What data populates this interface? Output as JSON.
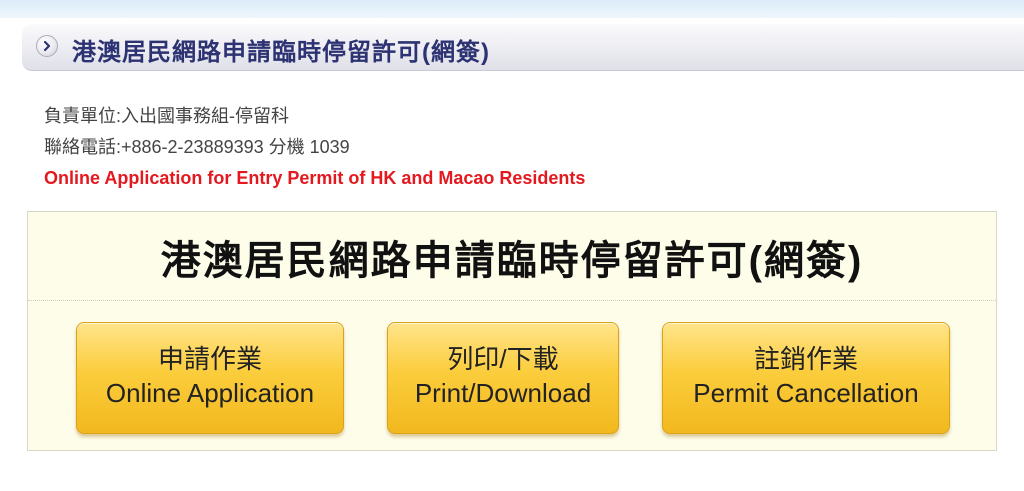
{
  "header": {
    "title": "港澳居民網路申請臨時停留許可(網簽)",
    "icon": "chevron-right-circle-icon"
  },
  "info": {
    "department": "負責單位:入出國事務組-停留科",
    "phone": "聯絡電話:+886-2-23889393 分機 1039",
    "english_title": "Online Application for Entry Permit of HK and Macao Residents"
  },
  "panel": {
    "heading": "港澳居民網路申請臨時停留許可(網簽)",
    "buttons": [
      {
        "label_zh": "申請作業",
        "label_en": "Online Application"
      },
      {
        "label_zh": "列印/下載",
        "label_en": "Print/Download"
      },
      {
        "label_zh": "註銷作業",
        "label_en": "Permit Cancellation"
      }
    ]
  },
  "colors": {
    "title_text": "#2c3272",
    "english_title": "#e3191f",
    "panel_background": "#fdfdea",
    "button_gold": "#fbcd3c"
  }
}
